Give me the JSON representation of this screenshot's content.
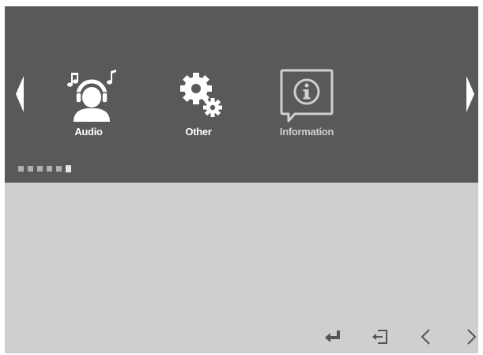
{
  "menu": {
    "items": [
      {
        "label": "Audio",
        "icon": "headphones-user-icon",
        "state": "normal"
      },
      {
        "label": "Other",
        "icon": "gears-icon",
        "state": "normal"
      },
      {
        "label": "Information",
        "icon": "info-icon",
        "state": "dimmed"
      }
    ],
    "pagination": {
      "total": 6,
      "active_index": 6
    }
  },
  "bottom_controls": {
    "icons": [
      "enter-icon",
      "exit-icon",
      "chevron-left-icon",
      "chevron-right-icon"
    ]
  },
  "colors": {
    "panel_background": "#595959",
    "screen_background": "#cfcfcf",
    "icon_active": "#ffffff",
    "icon_dimmed": "#cfcfcf",
    "control_icons": "#555555"
  }
}
